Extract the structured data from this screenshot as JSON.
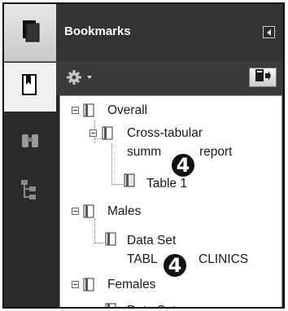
{
  "panel": {
    "title": "Bookmarks"
  },
  "tree": {
    "items": [
      {
        "label": "Overall"
      },
      {
        "label_line1": "Cross-tabular",
        "label_line2": "summ",
        "label_line2_tail": "report"
      },
      {
        "label": "Table 1"
      },
      {
        "label": "Males"
      },
      {
        "label_line1": "Data Set",
        "label_line2": "TABL",
        "label_line2_tail": "CLINICS"
      },
      {
        "label": "Females"
      },
      {
        "label": "Data Set"
      }
    ]
  },
  "callouts": {
    "badge1": "4",
    "badge2": "4"
  },
  "icons": {
    "left_top": "page-icon",
    "left_selected": "bookmark-icon",
    "left_3": "binoculars-icon",
    "left_4": "tree-structure-icon",
    "toolbar_menu": "gear-icon",
    "toolbar_action": "expand-bookmark-icon",
    "collapse": "collapse-panel-icon"
  }
}
